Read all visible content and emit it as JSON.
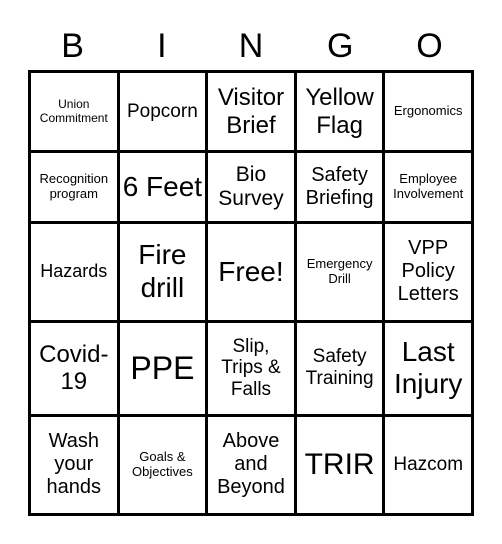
{
  "header": [
    "B",
    "I",
    "N",
    "G",
    "O"
  ],
  "cells": [
    [
      {
        "text": "Union Commitment",
        "size": 12
      },
      {
        "text": "Popcorn",
        "size": 19
      },
      {
        "text": "Visitor Brief",
        "size": 24
      },
      {
        "text": "Yellow Flag",
        "size": 24
      },
      {
        "text": "Ergonomics",
        "size": 13
      }
    ],
    [
      {
        "text": "Recognition program",
        "size": 13
      },
      {
        "text": "6 Feet",
        "size": 28
      },
      {
        "text": "Bio Survey",
        "size": 21
      },
      {
        "text": "Safety Briefing",
        "size": 20
      },
      {
        "text": "Employee Involvement",
        "size": 13
      }
    ],
    [
      {
        "text": "Hazards",
        "size": 18
      },
      {
        "text": "Fire drill",
        "size": 28
      },
      {
        "text": "Free!",
        "size": 28
      },
      {
        "text": "Emergency Drill",
        "size": 13
      },
      {
        "text": "VPP Policy Letters",
        "size": 20
      }
    ],
    [
      {
        "text": "Covid-19",
        "size": 24
      },
      {
        "text": "PPE",
        "size": 32
      },
      {
        "text": "Slip, Trips & Falls",
        "size": 19
      },
      {
        "text": "Safety Training",
        "size": 19
      },
      {
        "text": "Last Injury",
        "size": 28
      }
    ],
    [
      {
        "text": "Wash your hands",
        "size": 20
      },
      {
        "text": "Goals & Objectives",
        "size": 13
      },
      {
        "text": "Above and Beyond",
        "size": 20
      },
      {
        "text": "TRIR",
        "size": 30
      },
      {
        "text": "Hazcom",
        "size": 19
      }
    ]
  ]
}
